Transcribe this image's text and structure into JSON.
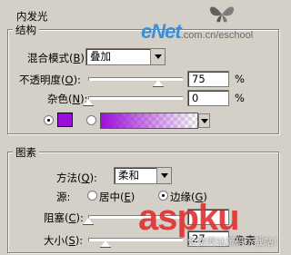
{
  "title": "内发光",
  "structure": {
    "legend": "结构",
    "blend_mode": {
      "label": "混合模式",
      "key": "B",
      "value": "叠加"
    },
    "opacity": {
      "label": "不透明度",
      "key": "O",
      "value": "75",
      "unit": "%",
      "level": 0.75
    },
    "noise": {
      "label": "杂色",
      "key": "N",
      "value": "0",
      "unit": "%",
      "level": 0
    }
  },
  "elements": {
    "legend": "图素",
    "technique": {
      "label": "方法",
      "key": "Q",
      "value": "柔和"
    },
    "source": {
      "label": "源",
      "option_center": "居中",
      "key_center": "E",
      "option_edge": "边缘",
      "key_edge": "G",
      "selected": "edge"
    },
    "choke": {
      "label": "阻塞",
      "key": "C"
    },
    "size": {
      "label": "大小",
      "key": "S",
      "value": "27",
      "unit": "像素"
    }
  },
  "colors": {
    "glow": "#9c0fd8"
  },
  "watermarks": {
    "enet": "eNet",
    "enet_sub": ".com.cn/eschool",
    "aspku": "aspku",
    "aspku_sub": "免费网站源码下载站!"
  }
}
